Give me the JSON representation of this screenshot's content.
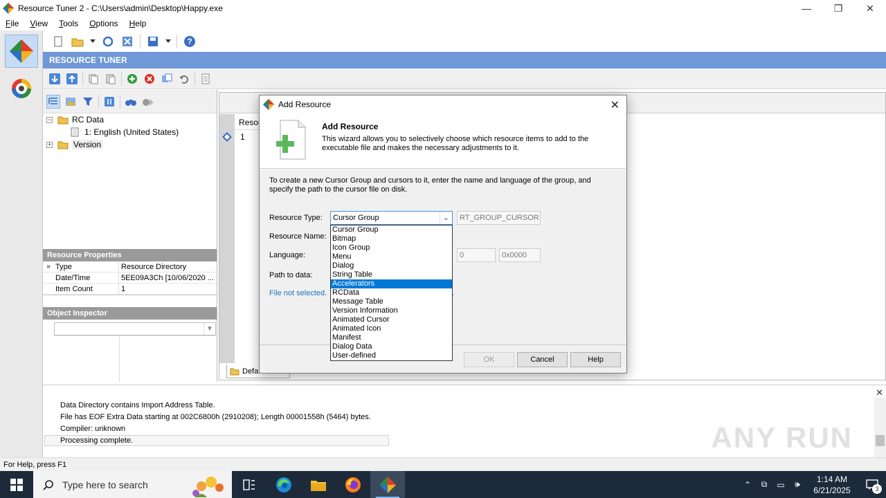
{
  "window": {
    "title": "Resource Tuner 2 - C:\\Users\\admin\\Desktop\\Happy.exe",
    "minimize": "—",
    "restore": "❐",
    "close": "✕"
  },
  "menu": {
    "items": [
      {
        "first": "F",
        "rest": "ile"
      },
      {
        "first": "V",
        "rest": "iew"
      },
      {
        "first": "T",
        "rest": "ools"
      },
      {
        "first": "O",
        "rest": "ptions"
      },
      {
        "first": "H",
        "rest": "elp"
      }
    ]
  },
  "header": {
    "title": "RESOURCE TUNER"
  },
  "tree": {
    "items": [
      {
        "label": "RC Data"
      },
      {
        "label": "1: English (United States)"
      },
      {
        "label": "Version"
      }
    ]
  },
  "properties": {
    "title": "Resource Properties",
    "rows": [
      {
        "key": "Type",
        "value": "Resource Directory"
      },
      {
        "key": "Date/Time",
        "value": "5EE09A3Ch  [10/06/2020 ..."
      },
      {
        "key": "Item Count",
        "value": "1"
      }
    ]
  },
  "inspector": {
    "title": "Object Inspector"
  },
  "right_pane": {
    "col_header": "Resou",
    "row1": "1",
    "tab_label": "Default View"
  },
  "log": {
    "lines": [
      "Data Directory contains Import Address Table.",
      "File has EOF Extra Data starting at 002C6800h (2910208); Length 00001558h (5464) bytes.",
      "Compiler: unknown",
      "Processing complete."
    ],
    "watermark": "ANY RUN"
  },
  "status": {
    "text": "For Help, press F1"
  },
  "taskbar": {
    "search_placeholder": "Type here to search",
    "time": "1:14 AM",
    "date": "6/21/2025",
    "notif_count": "3"
  },
  "dialog": {
    "title": "Add Resource",
    "header_title": "Add Resource",
    "header_desc": "This wizard allows you to selectively choose which resource items to add to the executable file and makes the necessary adjustments to it.",
    "intro": "To create a new Cursor Group and cursors to it, enter the name and language of the group, and specify the path to the cursor file on disk.",
    "labels": {
      "resource_type": "Resource Type:",
      "resource_name": "Resource Name:",
      "language": "Language:",
      "path": "Path to data:"
    },
    "resource_type_value": "Cursor Group",
    "rt_constant": "RT_GROUP_CURSOR",
    "lang_value1": "0",
    "lang_value2": "0x0000",
    "file_status": "File not selected.",
    "file_status_tail": ".",
    "buttons": {
      "ok": "OK",
      "cancel": "Cancel",
      "help": "Help"
    },
    "dropdown_options": [
      "Cursor Group",
      "Bitmap",
      "Icon Group",
      "Menu",
      "Dialog",
      "String Table",
      "Accelerators",
      "RCData",
      "Message Table",
      "Version Information",
      "Animated Cursor",
      "Animated Icon",
      "Manifest",
      "Dialog Data",
      "User-defined"
    ],
    "selected_option_index": 6
  },
  "colors": {
    "accent": "#6f98d8",
    "selection": "#0078d7",
    "link": "#1a73c5",
    "taskbar": "#1c2a3a"
  }
}
